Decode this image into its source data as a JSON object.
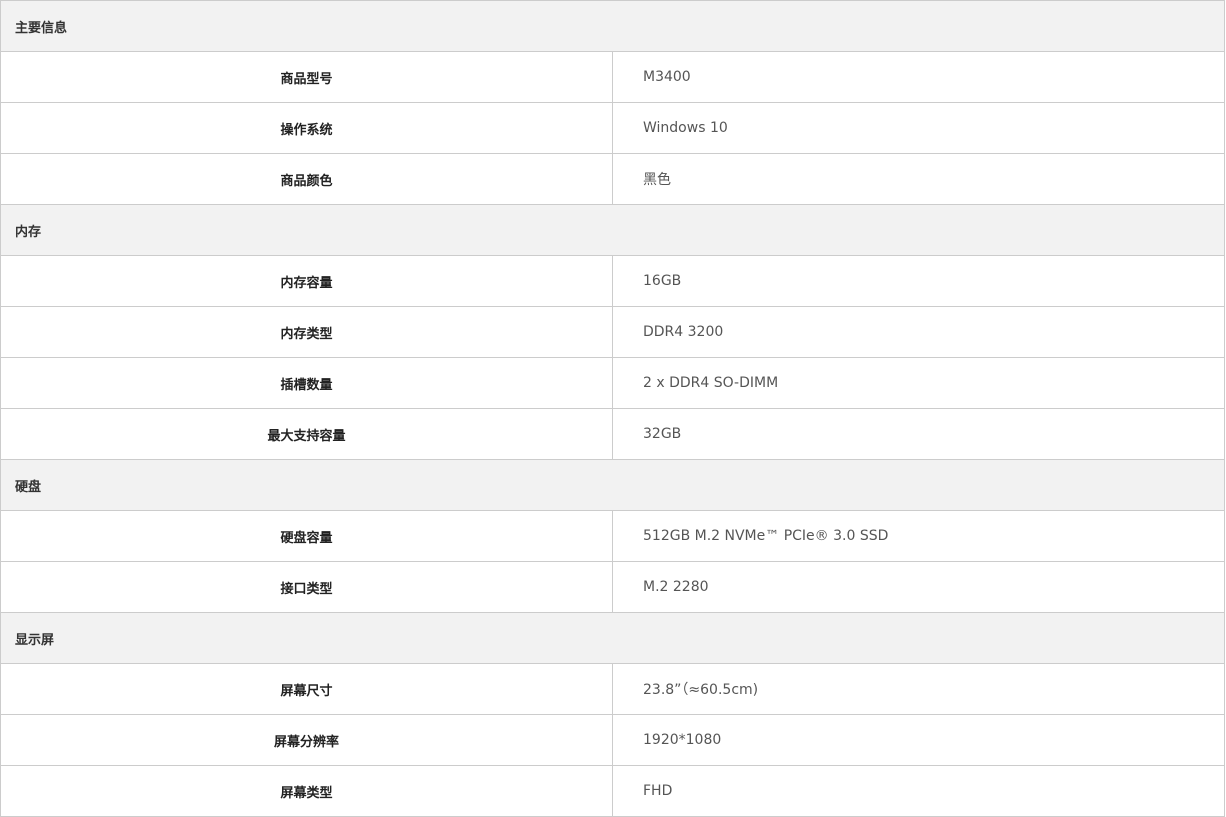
{
  "sections": [
    {
      "title": "主要信息",
      "rows": [
        {
          "label": "商品型号",
          "value": "M3400"
        },
        {
          "label": "操作系统",
          "value": "Windows 10"
        },
        {
          "label": "商品颜色",
          "value": "黑色"
        }
      ]
    },
    {
      "title": "内存",
      "rows": [
        {
          "label": "内存容量",
          "value": "16GB"
        },
        {
          "label": "内存类型",
          "value": "DDR4 3200"
        },
        {
          "label": "插槽数量",
          "value": "2 x DDR4 SO-DIMM"
        },
        {
          "label": "最大支持容量",
          "value": "32GB"
        }
      ]
    },
    {
      "title": "硬盘",
      "rows": [
        {
          "label": "硬盘容量",
          "value": "512GB M.2 NVMe™ PCIe® 3.0 SSD"
        },
        {
          "label": "接口类型",
          "value": "M.2 2280"
        }
      ]
    },
    {
      "title": "显示屏",
      "rows": [
        {
          "label": "屏幕尺寸",
          "value": "23.8”（≈60.5cm)"
        },
        {
          "label": "屏幕分辨率",
          "value": "1920*1080"
        },
        {
          "label": "屏幕类型",
          "value": "FHD"
        }
      ]
    }
  ],
  "colors": {
    "section_background": "#f2f2f2",
    "border": "#cccccc",
    "label_text": "#222222",
    "value_text": "#555555"
  }
}
